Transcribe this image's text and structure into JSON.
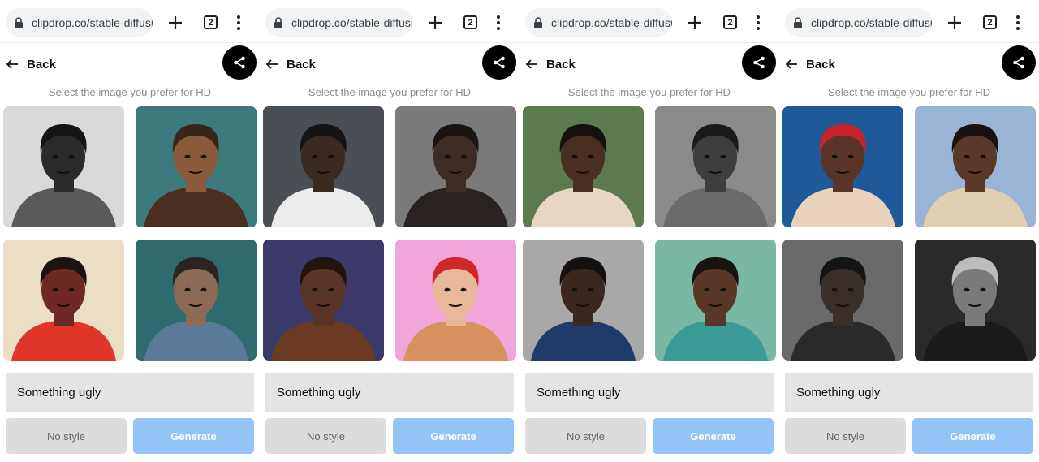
{
  "panels": [
    {
      "url": "clipdrop.co/stable-diffusion",
      "tab_count": "2",
      "back_label": "Back",
      "hint": "Select the image you prefer for HD",
      "prompt": "Something ugly",
      "style_label": "No style",
      "generate_label": "Generate",
      "images": [
        {
          "bg": "#d9d9d9",
          "skin": "#2b2b2b",
          "hair": "#151515",
          "cloth": "#5a5a5a"
        },
        {
          "bg": "#3d7a7e",
          "skin": "#8a5a3c",
          "hair": "#3a2418",
          "cloth": "#4a2e22"
        },
        {
          "bg": "#eadfc4",
          "skin": "#6e2a22",
          "hair": "#1c1412",
          "cloth": "#e0352b"
        },
        {
          "bg": "#2f6a6e",
          "skin": "#8c6a55",
          "hair": "#2b2420",
          "cloth": "#5a7a9a"
        }
      ]
    },
    {
      "url": "clipdrop.co/stable-diffusion",
      "tab_count": "2",
      "back_label": "Back",
      "hint": "Select the image you prefer for HD",
      "prompt": "Something ugly",
      "style_label": "No style",
      "generate_label": "Generate",
      "images": [
        {
          "bg": "#4a4f55",
          "skin": "#3a2a22",
          "hair": "#141414",
          "cloth": "#ececec"
        },
        {
          "bg": "#7a7a7a",
          "skin": "#3d2d26",
          "hair": "#1a1412",
          "cloth": "#2a2220"
        },
        {
          "bg": "#3c3a6a",
          "skin": "#5a3424",
          "hair": "#1e1410",
          "cloth": "#6a3a22"
        },
        {
          "bg": "#f0a6d8",
          "skin": "#e8b89a",
          "hair": "#d0282a",
          "cloth": "#d8905e"
        }
      ]
    },
    {
      "url": "clipdrop.co/stable-diffusion",
      "tab_count": "2",
      "back_label": "Back",
      "hint": "Select the image you prefer for HD",
      "prompt": "Something ugly",
      "style_label": "No style",
      "generate_label": "Generate",
      "images": [
        {
          "bg": "#5d7a4e",
          "skin": "#4a2e22",
          "hair": "#141010",
          "cloth": "#e6d6c2"
        },
        {
          "bg": "#8a8a8a",
          "skin": "#3e3e3e",
          "hair": "#1a1a1a",
          "cloth": "#6a6a6a"
        },
        {
          "bg": "#a8a8a8",
          "skin": "#3a2820",
          "hair": "#141010",
          "cloth": "#203a6a"
        },
        {
          "bg": "#7ab8a6",
          "skin": "#5a3626",
          "hair": "#181210",
          "cloth": "#3a9a94"
        }
      ]
    },
    {
      "url": "clipdrop.co/stable-diffusion",
      "tab_count": "2",
      "back_label": "Back",
      "hint": "Select the image you prefer for HD",
      "prompt": "Something ugly",
      "style_label": "No style",
      "generate_label": "Generate",
      "images": [
        {
          "bg": "#1e5a9a",
          "skin": "#5a3426",
          "hair": "#c8232c",
          "cloth": "#e8d2bc"
        },
        {
          "bg": "#9ab4d6",
          "skin": "#5a3a26",
          "hair": "#1a1210",
          "cloth": "#e0cfb0"
        },
        {
          "bg": "#6a6a6a",
          "skin": "#3a2e2a",
          "hair": "#141414",
          "cloth": "#2a2a2a"
        },
        {
          "bg": "#2a2a2a",
          "skin": "#7a7a7a",
          "hair": "#bcbcbc",
          "cloth": "#1a1a1a"
        }
      ]
    }
  ]
}
